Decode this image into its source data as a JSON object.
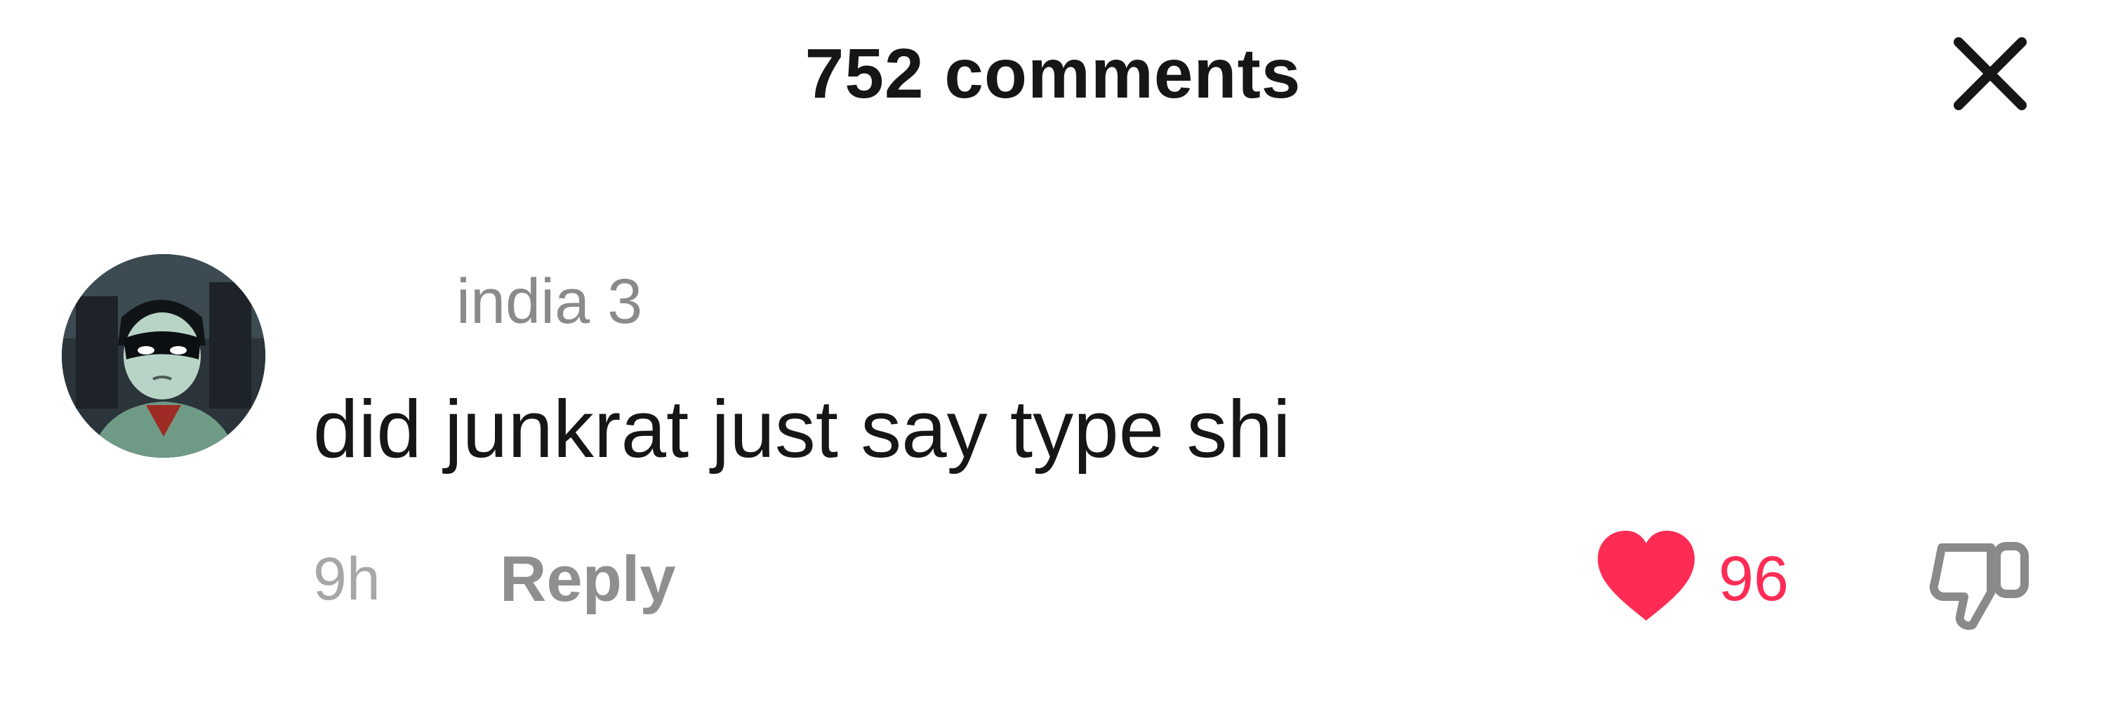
{
  "header": {
    "title": "752 comments"
  },
  "comment": {
    "username": "india 3",
    "text": "did junkrat just say type shi",
    "time": "9h",
    "reply_label": "Reply",
    "like_count": "96",
    "liked": true
  },
  "colors": {
    "like_red": "#fe2c55",
    "text_primary": "#161616",
    "text_secondary": "#8f8f8f"
  },
  "icons": {
    "close": "close-icon",
    "like": "heart-icon",
    "dislike": "thumbs-down-icon"
  }
}
